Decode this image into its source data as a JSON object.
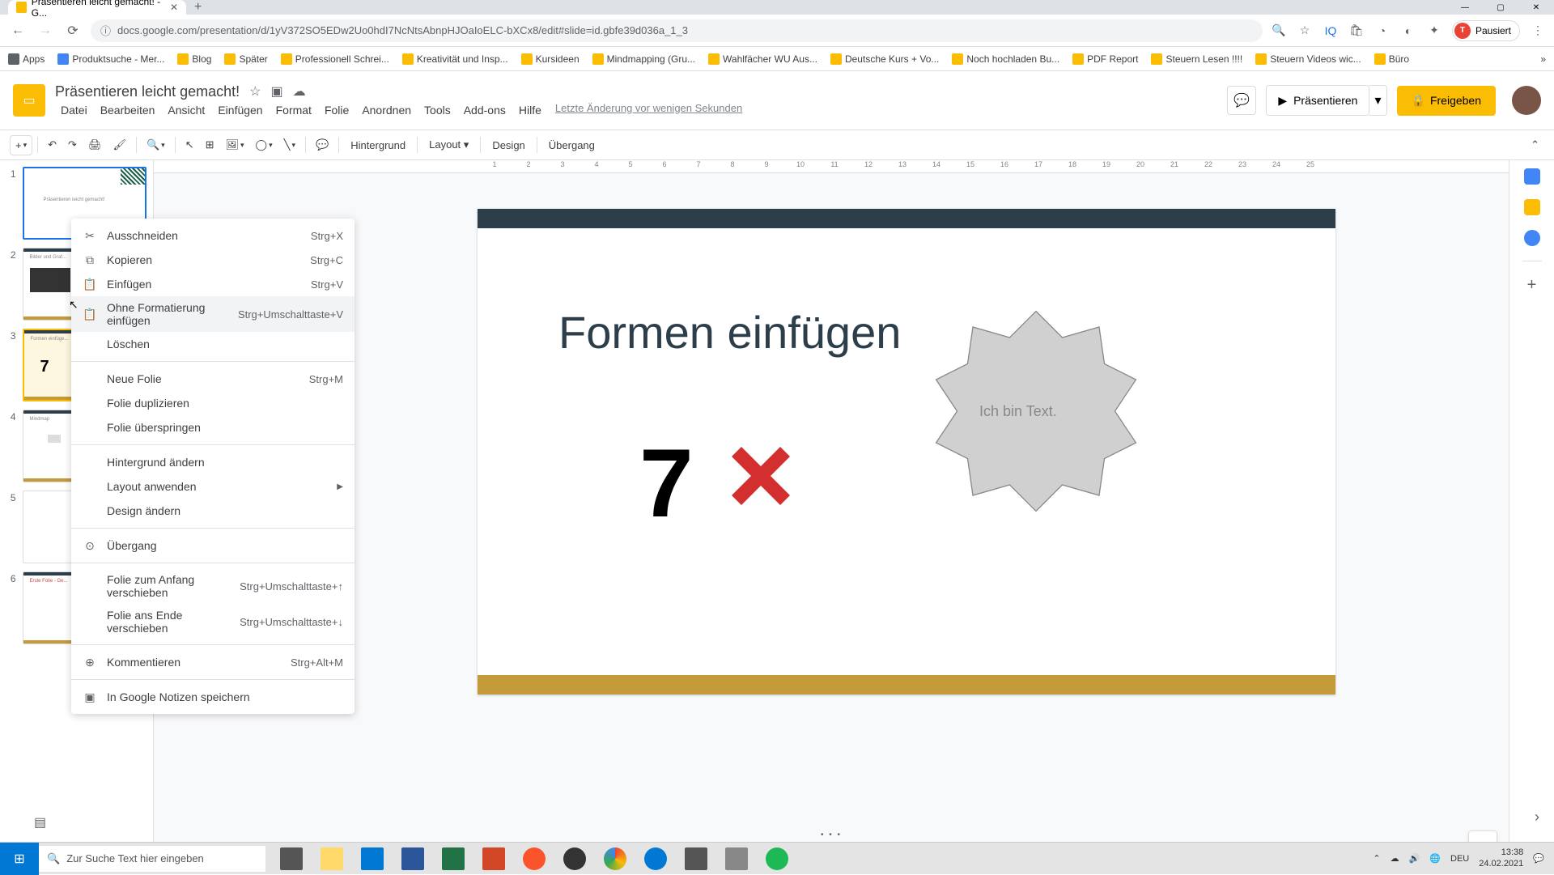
{
  "browser": {
    "tab_title": "Präsentieren leicht gemacht! - G...",
    "url": "docs.google.com/presentation/d/1yV372SO5EDw2Uo0hdI7NcNtsAbnpHJOaIoELC-bXCx8/edit#slide=id.gbfe39d036a_1_3",
    "profile_status": "Pausiert"
  },
  "bookmarks": [
    {
      "label": "Apps",
      "color": "#5f6368"
    },
    {
      "label": "Produktsuche - Mer...",
      "color": "#4285f4"
    },
    {
      "label": "Blog",
      "color": "#fbbc04"
    },
    {
      "label": "Später",
      "color": "#fbbc04"
    },
    {
      "label": "Professionell Schrei...",
      "color": "#fbbc04"
    },
    {
      "label": "Kreativität und Insp...",
      "color": "#fbbc04"
    },
    {
      "label": "Kursideen",
      "color": "#fbbc04"
    },
    {
      "label": "Mindmapping (Gru...",
      "color": "#fbbc04"
    },
    {
      "label": "Wahlfächer WU Aus...",
      "color": "#fbbc04"
    },
    {
      "label": "Deutsche Kurs + Vo...",
      "color": "#fbbc04"
    },
    {
      "label": "Noch hochladen Bu...",
      "color": "#fbbc04"
    },
    {
      "label": "PDF Report",
      "color": "#fbbc04"
    },
    {
      "label": "Steuern Lesen !!!!",
      "color": "#fbbc04"
    },
    {
      "label": "Steuern Videos wic...",
      "color": "#fbbc04"
    },
    {
      "label": "Büro",
      "color": "#fbbc04"
    }
  ],
  "doc": {
    "title": "Präsentieren leicht gemacht!",
    "menus": [
      "Datei",
      "Bearbeiten",
      "Ansicht",
      "Einfügen",
      "Format",
      "Folie",
      "Anordnen",
      "Tools",
      "Add-ons",
      "Hilfe"
    ],
    "last_edit": "Letzte Änderung vor wenigen Sekunden",
    "present": "Präsentieren",
    "share": "Freigeben"
  },
  "toolbar": {
    "background": "Hintergrund",
    "layout": "Layout",
    "design": "Design",
    "transition": "Übergang"
  },
  "ruler": [
    "1",
    "2",
    "3",
    "4",
    "5",
    "6",
    "7",
    "8",
    "9",
    "10",
    "11",
    "12",
    "13",
    "14",
    "15",
    "16",
    "17",
    "18",
    "19",
    "20",
    "21",
    "22",
    "23",
    "24",
    "25"
  ],
  "slides": [
    {
      "num": "1",
      "title": "Präsentieren leicht gemacht!"
    },
    {
      "num": "2",
      "title": "Bilder und Graf..."
    },
    {
      "num": "3",
      "title": "Formen einfüge..."
    },
    {
      "num": "4",
      "title": "Mindmap"
    },
    {
      "num": "5",
      "title": ""
    },
    {
      "num": "6",
      "title": "Erste Folie - Ge..."
    }
  ],
  "current_slide": {
    "title": "Formen einfügen",
    "big_number": "7",
    "shape_text": "Ich bin Text."
  },
  "context_menu": [
    {
      "icon": "✂",
      "label": "Ausschneiden",
      "shortcut": "Strg+X"
    },
    {
      "icon": "⧉",
      "label": "Kopieren",
      "shortcut": "Strg+C"
    },
    {
      "icon": "📋",
      "label": "Einfügen",
      "shortcut": "Strg+V"
    },
    {
      "icon": "📋",
      "label": "Ohne Formatierung einfügen",
      "shortcut": "Strg+Umschalttaste+V",
      "hover": true
    },
    {
      "icon": "",
      "label": "Löschen",
      "shortcut": ""
    },
    {
      "sep": true
    },
    {
      "icon": "",
      "label": "Neue Folie",
      "shortcut": "Strg+M"
    },
    {
      "icon": "",
      "label": "Folie duplizieren",
      "shortcut": ""
    },
    {
      "icon": "",
      "label": "Folie überspringen",
      "shortcut": ""
    },
    {
      "sep": true
    },
    {
      "icon": "",
      "label": "Hintergrund ändern",
      "shortcut": ""
    },
    {
      "icon": "",
      "label": "Layout anwenden",
      "shortcut": "",
      "submenu": true
    },
    {
      "icon": "",
      "label": "Design ändern",
      "shortcut": ""
    },
    {
      "sep": true
    },
    {
      "icon": "⊙",
      "label": "Übergang",
      "shortcut": ""
    },
    {
      "sep": true
    },
    {
      "icon": "",
      "label": "Folie zum Anfang verschieben",
      "shortcut": "Strg+Umschalttaste+↑"
    },
    {
      "icon": "",
      "label": "Folie ans Ende verschieben",
      "shortcut": "Strg+Umschalttaste+↓"
    },
    {
      "sep": true
    },
    {
      "icon": "⊕",
      "label": "Kommentieren",
      "shortcut": "Strg+Alt+M"
    },
    {
      "sep": true
    },
    {
      "icon": "▣",
      "label": "In Google Notizen speichern",
      "shortcut": ""
    }
  ],
  "taskbar": {
    "search_placeholder": "Zur Suche Text hier eingeben",
    "lang": "DEU",
    "time": "13:38",
    "date": "24.02.2021"
  }
}
